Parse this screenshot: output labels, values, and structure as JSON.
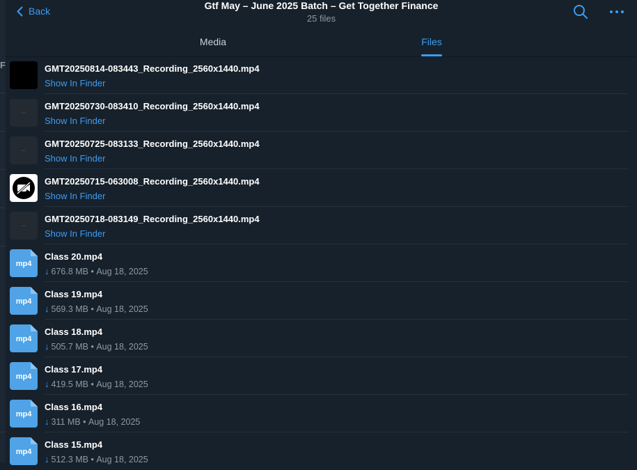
{
  "header": {
    "back_label": "Back",
    "title": "Gtf May – June 2025 Batch – Get Together Finance",
    "subtitle": "25 files"
  },
  "left_strip": {
    "letter": "F"
  },
  "tabs": [
    {
      "label": "Media",
      "active": false
    },
    {
      "label": "Files",
      "active": true
    }
  ],
  "recordings": [
    {
      "name": "GMT20250814-083443_Recording_2560x1440.mp4",
      "action": "Show In Finder",
      "thumb": "black"
    },
    {
      "name": "GMT20250730-083410_Recording_2560x1440.mp4",
      "action": "Show In Finder",
      "thumb": "dark"
    },
    {
      "name": "GMT20250725-083133_Recording_2560x1440.mp4",
      "action": "Show In Finder",
      "thumb": "dark"
    },
    {
      "name": "GMT20250715-063008_Recording_2560x1440.mp4",
      "action": "Show In Finder",
      "thumb": "video-off"
    },
    {
      "name": "GMT20250718-083149_Recording_2560x1440.mp4",
      "action": "Show In Finder",
      "thumb": "dark"
    }
  ],
  "files": [
    {
      "name": "Class 20.mp4",
      "ext": "mp4",
      "size": "676.8 MB",
      "date": "Aug 18, 2025"
    },
    {
      "name": "Class 19.mp4",
      "ext": "mp4",
      "size": "569.3 MB",
      "date": "Aug 18, 2025"
    },
    {
      "name": "Class 18.mp4",
      "ext": "mp4",
      "size": "505.7 MB",
      "date": "Aug 18, 2025"
    },
    {
      "name": "Class 17.mp4",
      "ext": "mp4",
      "size": "419.5 MB",
      "date": "Aug 18, 2025"
    },
    {
      "name": "Class 16.mp4",
      "ext": "mp4",
      "size": "311 MB",
      "date": "Aug 18, 2025"
    },
    {
      "name": "Class 15.mp4",
      "ext": "mp4",
      "size": "512.3 MB",
      "date": "Aug 18, 2025"
    }
  ],
  "colors": {
    "background": "#17212b",
    "accent": "#3e9cf0",
    "muted": "#8d99a6",
    "file_icon": "#4fa3e6"
  },
  "icons": {
    "back": "chevron-left-icon",
    "search": "search-icon",
    "more": "more-dots-icon",
    "download": "download-arrow-icon",
    "video_off": "video-off-icon"
  }
}
